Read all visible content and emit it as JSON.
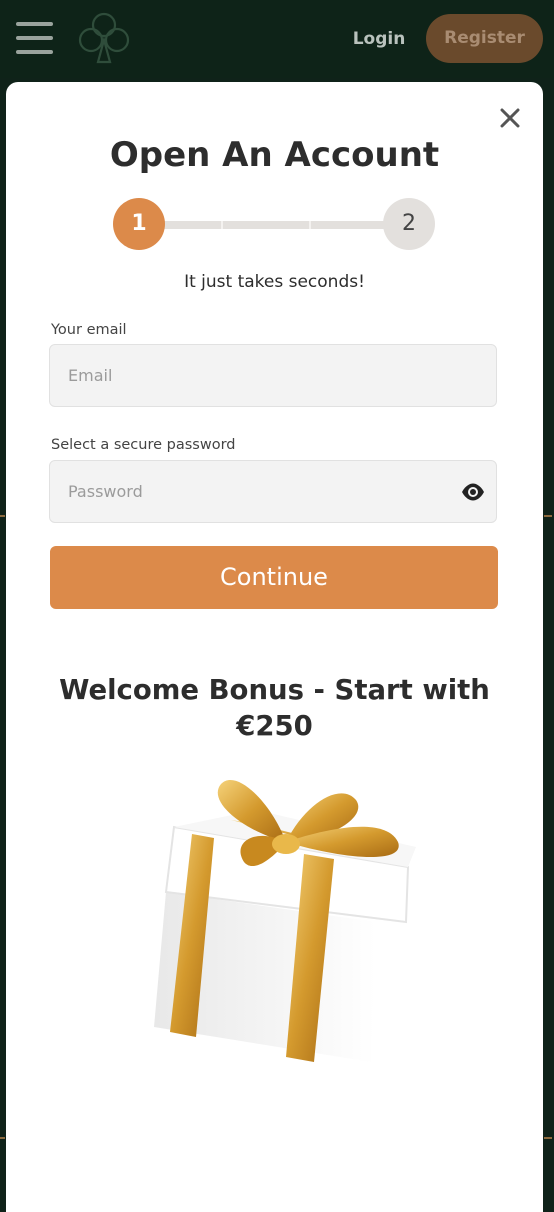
{
  "header": {
    "login_label": "Login",
    "register_label": "Register"
  },
  "modal": {
    "title": "Open An Account",
    "stepper": {
      "step1": "1",
      "step2": "2",
      "current_step": 1
    },
    "subtitle": "It just takes seconds!",
    "email": {
      "label": "Your email",
      "placeholder": "Email",
      "value": ""
    },
    "password": {
      "label": "Select a secure password",
      "placeholder": "Password",
      "value": ""
    },
    "continue_label": "Continue",
    "bonus_title": "Welcome Bonus - Start with €250"
  },
  "icons": {
    "menu": "hamburger-menu-icon",
    "logo": "clover-logo",
    "close": "close-icon",
    "eye": "eye-icon",
    "gift": "gift-box-image"
  },
  "colors": {
    "header_bg": "#0e2318",
    "accent": "#dc8a4a",
    "register_bg": "#6a4a2c",
    "text_dark": "#2d2d2d"
  }
}
